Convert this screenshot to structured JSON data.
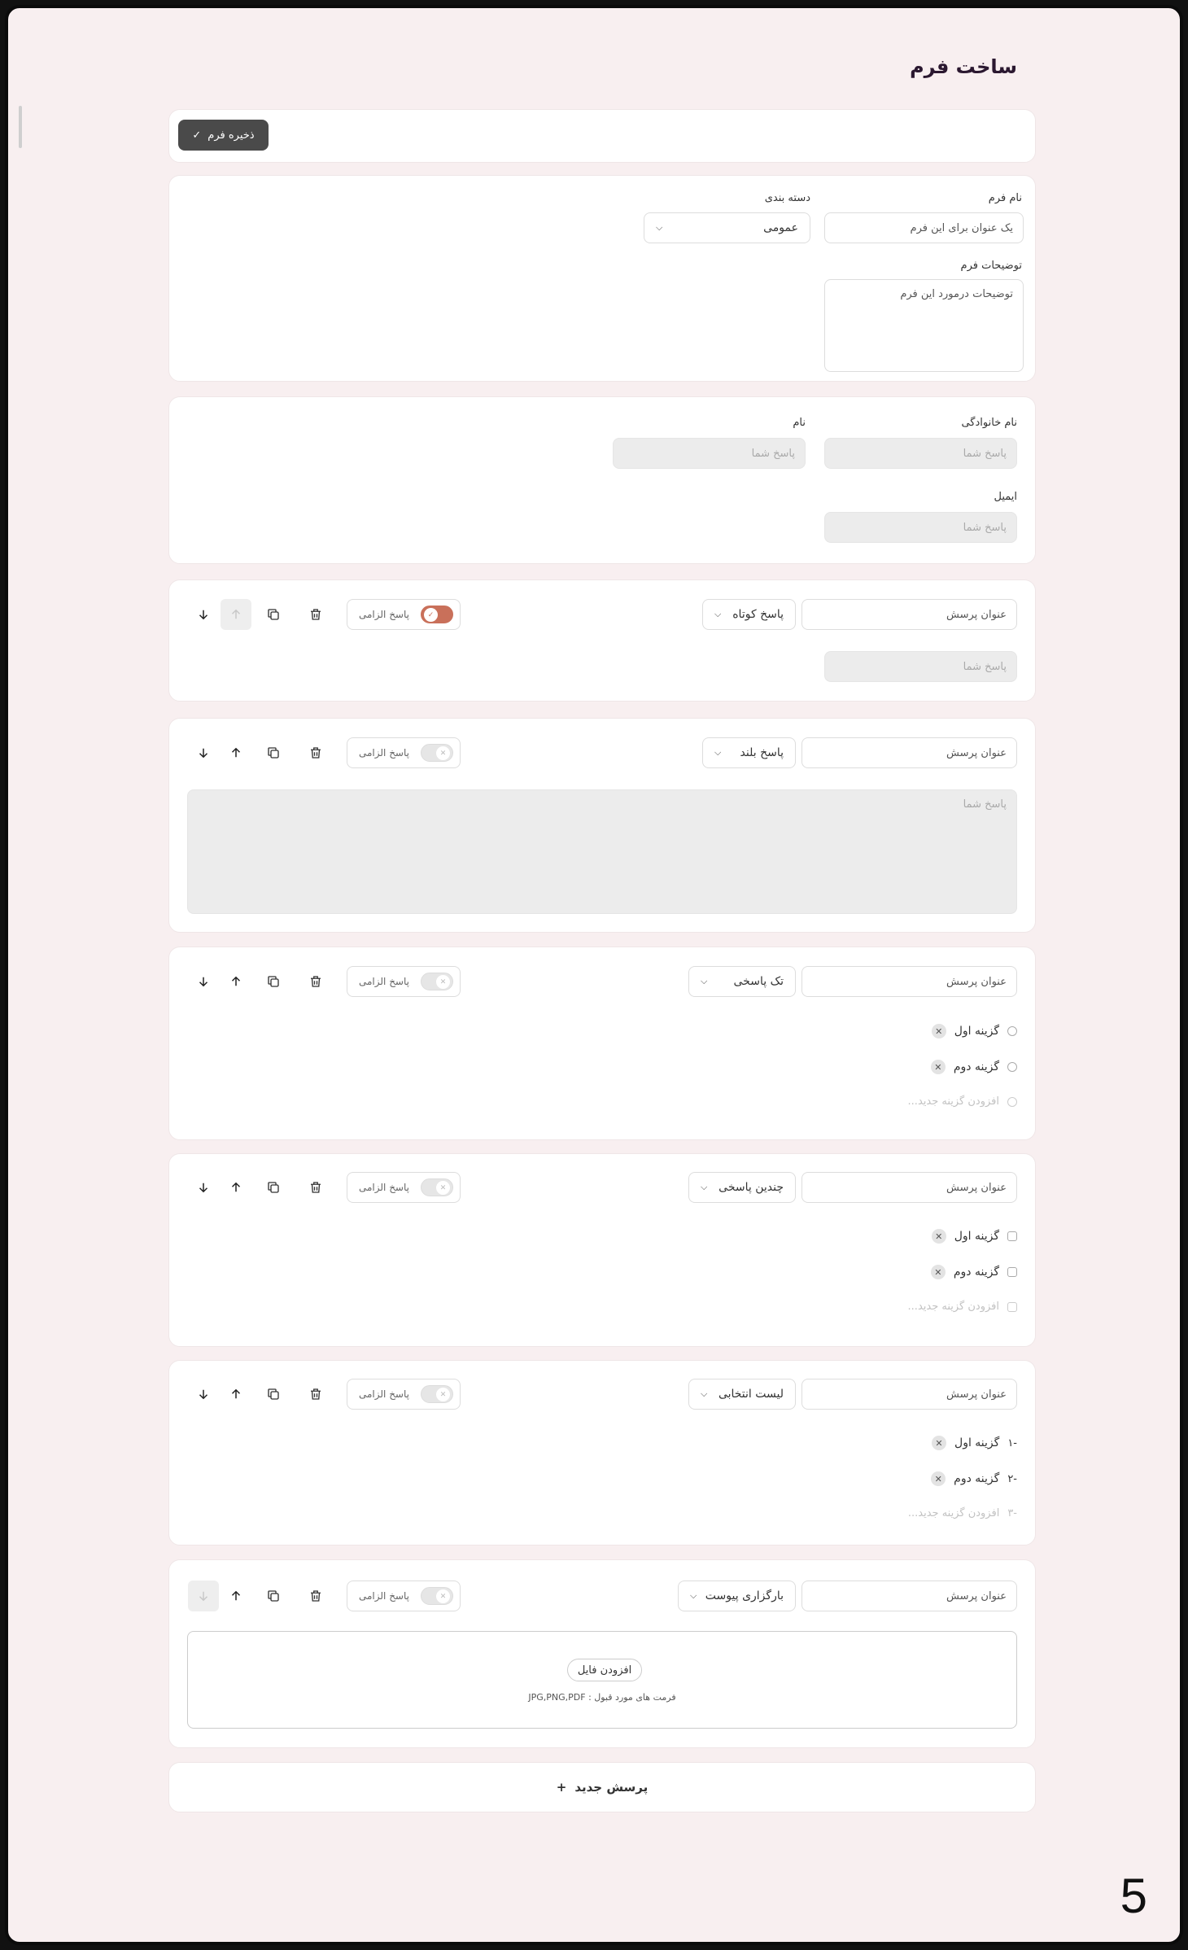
{
  "page": {
    "title": "ساخت فرم",
    "page_number": "5"
  },
  "toolbar": {
    "save_label": "ذخیره فرم"
  },
  "form_info": {
    "name_label": "نام فرم",
    "name_placeholder": "یک عنوان برای این فرم",
    "category_label": "دسته بندی",
    "category_value": "عمومی",
    "description_label": "توضیحات فرم",
    "description_placeholder": "توضیحات درمورد این فرم"
  },
  "default_fields": {
    "last_name_label": "نام خانوادگی",
    "first_name_label": "نام",
    "email_label": "ایمیل",
    "answer_placeholder": "پاسخ شما"
  },
  "question_common": {
    "title_placeholder": "عنوان پرسش",
    "required_label": "پاسخ الزامی",
    "answer_placeholder": "پاسخ شما",
    "add_option_label": "افزودن گزینه جدید..."
  },
  "questions": [
    {
      "type_label": "پاسخ کوتاه",
      "required": true
    },
    {
      "type_label": "پاسخ بلند",
      "required": false
    },
    {
      "type_label": "تک پاسخی",
      "required": false,
      "options": [
        "گزینه اول",
        "گزینه دوم"
      ]
    },
    {
      "type_label": "چندین پاسخی",
      "required": false,
      "options": [
        "گزینه اول",
        "گزینه دوم"
      ]
    },
    {
      "type_label": "لیست انتخابی",
      "required": false,
      "options": [
        "گزینه اول",
        "گزینه دوم"
      ],
      "numbers": [
        "-۱",
        "-۲",
        "-۳"
      ]
    },
    {
      "type_label": "بارگزاری پیوست",
      "required": false,
      "upload_button": "افزودن فایل",
      "upload_hint": "فرمت های مورد قبول : JPG,PNG,PDF"
    }
  ],
  "add_question_label": "پرسش جدید",
  "icons": {
    "move_down": "arrow-down-icon",
    "move_up": "arrow-up-icon",
    "duplicate": "copy-icon",
    "delete": "trash-icon",
    "dropdown": "chevron-down-icon",
    "check": "check-icon",
    "remove": "close-icon",
    "add": "plus-icon"
  },
  "colors": {
    "background": "#f8eff0",
    "toggle_on": "#c9705a",
    "save_button": "#4a4a4a"
  }
}
